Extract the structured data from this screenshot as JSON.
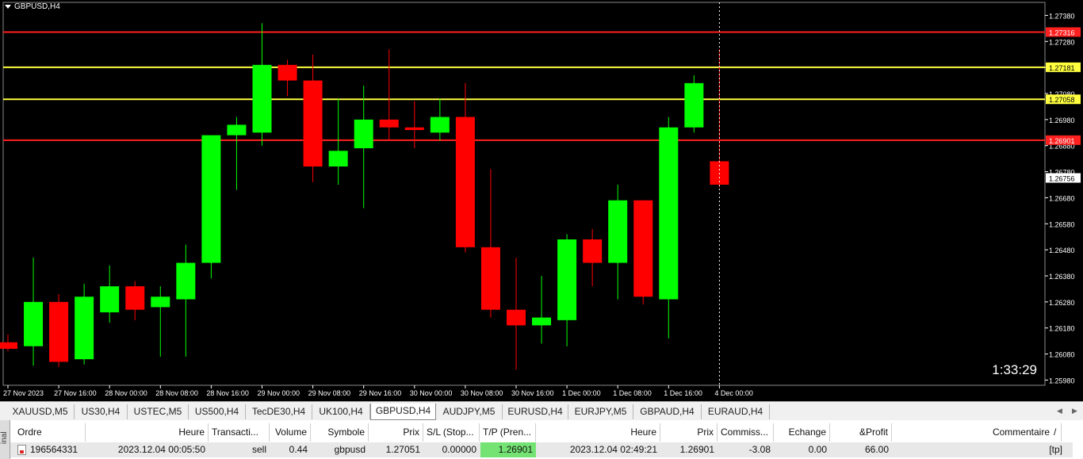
{
  "chart": {
    "title": "GBPUSD,H4",
    "countdown": "1:33:29",
    "price_axis": [
      "1.27380",
      "1.27280",
      "1.27180",
      "1.27080",
      "1.26980",
      "1.26880",
      "1.26780",
      "1.26680",
      "1.26580",
      "1.26480",
      "1.26380",
      "1.26280",
      "1.26180",
      "1.26080",
      "1.25980"
    ],
    "time_axis": [
      "27 Nov 2023",
      "27 Nov 16:00",
      "28 Nov 00:00",
      "28 Nov 08:00",
      "28 Nov 16:00",
      "29 Nov 00:00",
      "29 Nov 08:00",
      "29 Nov 16:00",
      "30 Nov 00:00",
      "30 Nov 08:00",
      "30 Nov 16:00",
      "1 Dec 00:00",
      "1 Dec 08:00",
      "1 Dec 16:00",
      "4 Dec 00:00"
    ],
    "horizontal_lines": [
      {
        "price": 1.27316,
        "label": "1.27316",
        "color": "#ff2020",
        "label_text_color": "#ffffff"
      },
      {
        "price": 1.27181,
        "label": "1.27181",
        "color": "#ffff40",
        "label_text_color": "#000000"
      },
      {
        "price": 1.27058,
        "label": "1.27058",
        "color": "#ffff40",
        "label_text_color": "#000000"
      },
      {
        "price": 1.26901,
        "label": "1.26901",
        "color": "#ff2020",
        "label_text_color": "#ffffff"
      }
    ],
    "current_price": {
      "value": 1.26756,
      "label": "1.26756"
    },
    "colors": {
      "bull": "#00ff00",
      "bear": "#ff0000",
      "background": "#000000",
      "axis_text": "#ffffff",
      "grid_line": "#606060"
    }
  },
  "chart_data": {
    "type": "candlestick",
    "ylim": [
      1.2593,
      1.2739
    ],
    "candles": [
      {
        "o": 1.26125,
        "h": 1.26155,
        "l": 1.2609,
        "c": 1.261
      },
      {
        "o": 1.2611,
        "h": 1.2645,
        "l": 1.26035,
        "c": 1.2628
      },
      {
        "o": 1.2628,
        "h": 1.2631,
        "l": 1.2603,
        "c": 1.2605
      },
      {
        "o": 1.2606,
        "h": 1.2635,
        "l": 1.2604,
        "c": 1.263
      },
      {
        "o": 1.2624,
        "h": 1.2642,
        "l": 1.262,
        "c": 1.2634
      },
      {
        "o": 1.2634,
        "h": 1.2636,
        "l": 1.2621,
        "c": 1.2625
      },
      {
        "o": 1.2626,
        "h": 1.2634,
        "l": 1.2607,
        "c": 1.263
      },
      {
        "o": 1.2629,
        "h": 1.265,
        "l": 1.2607,
        "c": 1.2643
      },
      {
        "o": 1.2643,
        "h": 1.2688,
        "l": 1.2637,
        "c": 1.2692
      },
      {
        "o": 1.2692,
        "h": 1.2699,
        "l": 1.2671,
        "c": 1.2696
      },
      {
        "o": 1.2693,
        "h": 1.2735,
        "l": 1.2688,
        "c": 1.2719
      },
      {
        "o": 1.2719,
        "h": 1.2721,
        "l": 1.2707,
        "c": 1.2713
      },
      {
        "o": 1.2713,
        "h": 1.2723,
        "l": 1.2674,
        "c": 1.268
      },
      {
        "o": 1.268,
        "h": 1.2706,
        "l": 1.2673,
        "c": 1.2686
      },
      {
        "o": 1.2687,
        "h": 1.2711,
        "l": 1.2664,
        "c": 1.2698
      },
      {
        "o": 1.2698,
        "h": 1.2725,
        "l": 1.269,
        "c": 1.2695
      },
      {
        "o": 1.2695,
        "h": 1.2705,
        "l": 1.2687,
        "c": 1.2694
      },
      {
        "o": 1.2693,
        "h": 1.2706,
        "l": 1.269,
        "c": 1.2699
      },
      {
        "o": 1.2699,
        "h": 1.2712,
        "l": 1.2647,
        "c": 1.2649
      },
      {
        "o": 1.2649,
        "h": 1.2679,
        "l": 1.2622,
        "c": 1.2625
      },
      {
        "o": 1.2625,
        "h": 1.2645,
        "l": 1.2602,
        "c": 1.2619
      },
      {
        "o": 1.2619,
        "h": 1.2638,
        "l": 1.2612,
        "c": 1.2622
      },
      {
        "o": 1.2621,
        "h": 1.2654,
        "l": 1.2611,
        "c": 1.2652
      },
      {
        "o": 1.2652,
        "h": 1.2656,
        "l": 1.2634,
        "c": 1.2643
      },
      {
        "o": 1.2643,
        "h": 1.2673,
        "l": 1.2629,
        "c": 1.2667
      },
      {
        "o": 1.2667,
        "h": 1.2667,
        "l": 1.2627,
        "c": 1.263
      },
      {
        "o": 1.2629,
        "h": 1.2699,
        "l": 1.2614,
        "c": 1.2695
      },
      {
        "o": 1.2695,
        "h": 1.2715,
        "l": 1.2693,
        "c": 1.2712
      },
      {
        "o": 1.2682,
        "h": 1.2725,
        "l": 1.2672,
        "c": 1.2673
      }
    ]
  },
  "tabs": [
    "XAUUSD,M5",
    "US30,H4",
    "USTEC,M5",
    "US500,H4",
    "TecDE30,H4",
    "UK100,H4",
    "GBPUSD,H4",
    "AUDJPY,M5",
    "EURUSD,H4",
    "EURJPY,M5",
    "GBPAUD,H4",
    "EURAUD,H4"
  ],
  "active_tab": "GBPUSD,H4",
  "terminal": {
    "side_label": "inal",
    "headers": [
      "Ordre",
      "Heure",
      "Transacti...",
      "Volume",
      "Symbole",
      "Prix",
      "S/L (Stop...",
      "T/P (Pren...",
      "Heure",
      "Prix",
      "Commiss...",
      "Echange",
      "&Profit",
      "Commentaire"
    ],
    "row": [
      "196564331",
      "2023.12.04 00:05:50",
      "sell",
      "0.44",
      "gbpusd",
      "1.27051",
      "0.00000",
      "1.26901",
      "2023.12.04 02:49:21",
      "1.26901",
      "-3.08",
      "0.00",
      "66.00",
      "[tp]"
    ],
    "sort_indicator": "/"
  }
}
